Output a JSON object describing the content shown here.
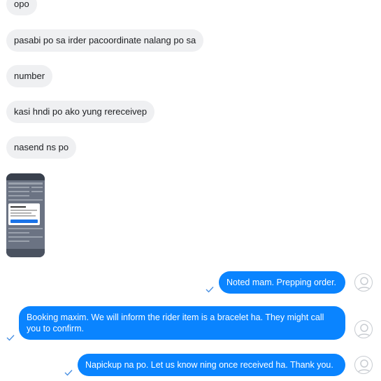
{
  "incoming": [
    {
      "text": "opo"
    },
    {
      "text": "pasabi po sa irder pacoordinate nalang po sa"
    },
    {
      "text": "number"
    },
    {
      "text": "kasi hndi po ako yung rereceivep"
    },
    {
      "text": "nasend ns po"
    }
  ],
  "attachment": {
    "icon": "screenshot-image"
  },
  "outgoing": [
    {
      "text": "Noted mam. Prepping order.",
      "status_icon": "check-icon"
    },
    {
      "text": "Booking maxim. We will inform the rider item is a bracelet ha. They might call you to confirm.",
      "status_icon": "check-icon"
    },
    {
      "text": "Napickup na po. Let us know ning once received ha. Thank you.",
      "status_icon": "check-icon"
    }
  ],
  "colors": {
    "outgoing_bubble": "#0a84ff",
    "incoming_bubble": "#eff0f2",
    "check": "#4a90e2"
  }
}
